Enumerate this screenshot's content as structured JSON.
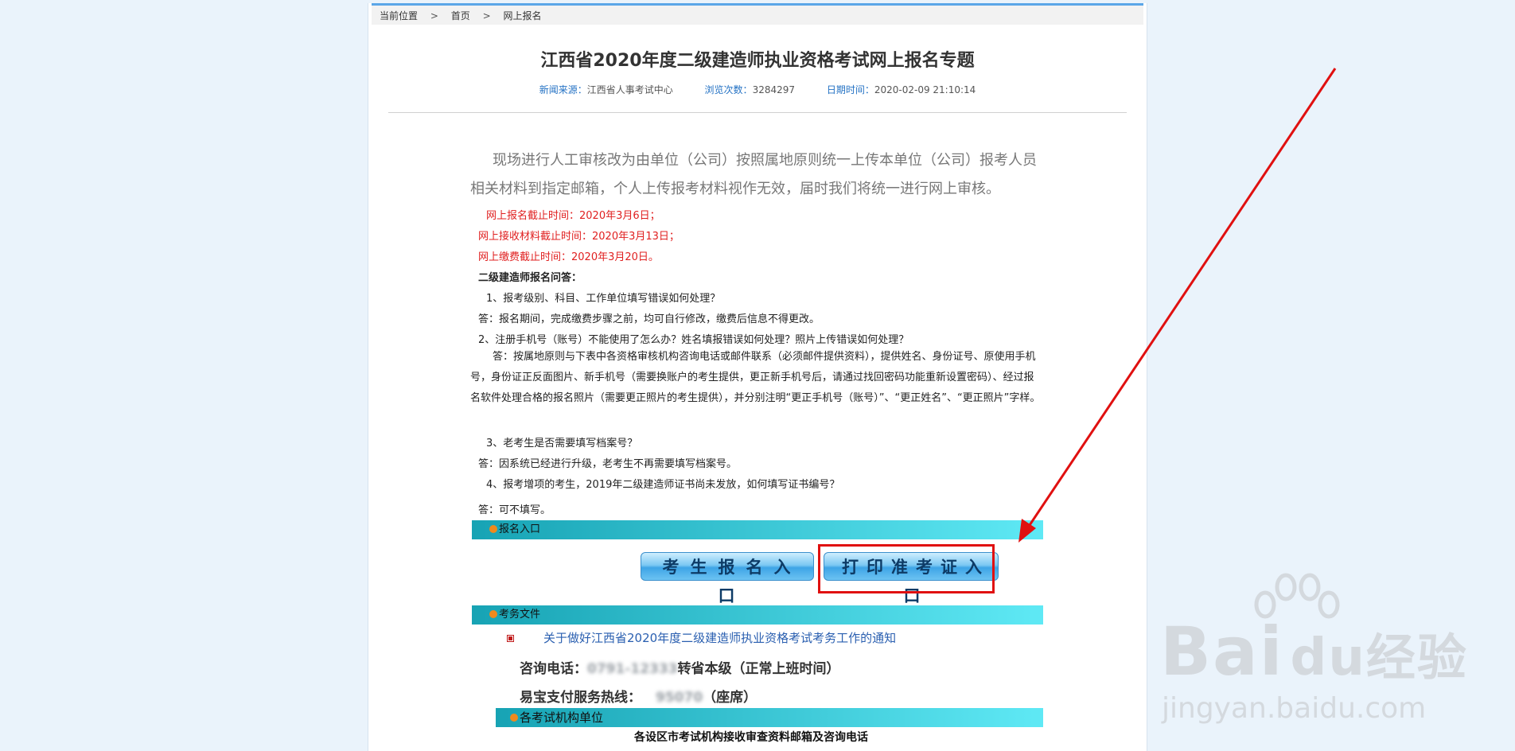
{
  "breadcrumb": {
    "current_label": "当前位置",
    "sep": ">",
    "home": "首页",
    "page": "网上报名"
  },
  "article": {
    "title": "江西省2020年度二级建造师执业资格考试网上报名专题",
    "meta": {
      "source_label": "新闻来源：",
      "source_value": "江西省人事考试中心",
      "views_label": "浏览次数：",
      "views_value": "3284297",
      "date_label": "日期时间：",
      "date_value": "2020-02-09 21:10:14"
    },
    "intro": "现场进行人工审核改为由单位（公司）按照属地原则统一上传本单位（公司）报考人员相关材料到指定邮箱，个人上传报考材料视作无效，届时我们将统一进行网上审核。",
    "deadlines": [
      "网上报名截止时间：2020年3月6日；",
      "网上接收材料截止时间：2020年3月13日；",
      "网上缴费截止时间：2020年3月20日。"
    ],
    "faq_title": "二级建造师报名问答：",
    "q1": "1、报考级别、科目、工作单位填写错误如何处理？",
    "a1": "答：报名期间，完成缴费步骤之前，均可自行修改，缴费后信息不得更改。",
    "q2": "2、注册手机号（账号）不能使用了怎么办？姓名填报错误如何处理？照片上传错误如何处理？",
    "a2": "答：按属地原则与下表中各资格审核机构咨询电话或邮件联系（必须邮件提供资料），提供姓名、身份证号、原使用手机号，身份证正反面图片、新手机号（需要换账户的考生提供，更正新手机号后，请通过找回密码功能重新设置密码）、经过报名软件处理合格的报名照片（需要更正照片的考生提供），并分别注明“更正手机号（账号）”、“更正姓名”、“更正照片”字样。",
    "q3": "3、老考生是否需要填写档案号？",
    "a3": "答：因系统已经进行升级，老考生不再需要填写档案号。",
    "q4": "4、报考增项的考生，2019年二级建造师证书尚未发放，如何填写证书编号？",
    "a4": "答：可不填写。"
  },
  "sections": {
    "entry_title": "报名入口",
    "register_button": "考生报名入口",
    "print_button": "打印准考证入口",
    "docs_title": "考务文件",
    "doc_link": "关于做好江西省2020年度二级建造师执业资格考试考务工作的通知",
    "phone_label": "咨询电话：",
    "phone_value": "0791-12333",
    "phone_suffix": "转省本级（正常上班时间）",
    "pay_label": "易宝支付服务热线：",
    "pay_value": "95070",
    "pay_suffix": "（座席）",
    "units_title": "各考试机构单位",
    "units_sub": "各设区市考试机构接收审查资料邮箱及咨询电话"
  },
  "watermark": {
    "brand": "Bai",
    "brand_du": "du",
    "brand_cn": "经验",
    "url": "jingyan.baidu.com"
  },
  "colors": {
    "accent_blue": "#5aa6e8",
    "deadline_red": "#e02020",
    "bar_start": "#17a3b4",
    "bar_end": "#5fe9f5",
    "annotation_red": "#e01010"
  }
}
